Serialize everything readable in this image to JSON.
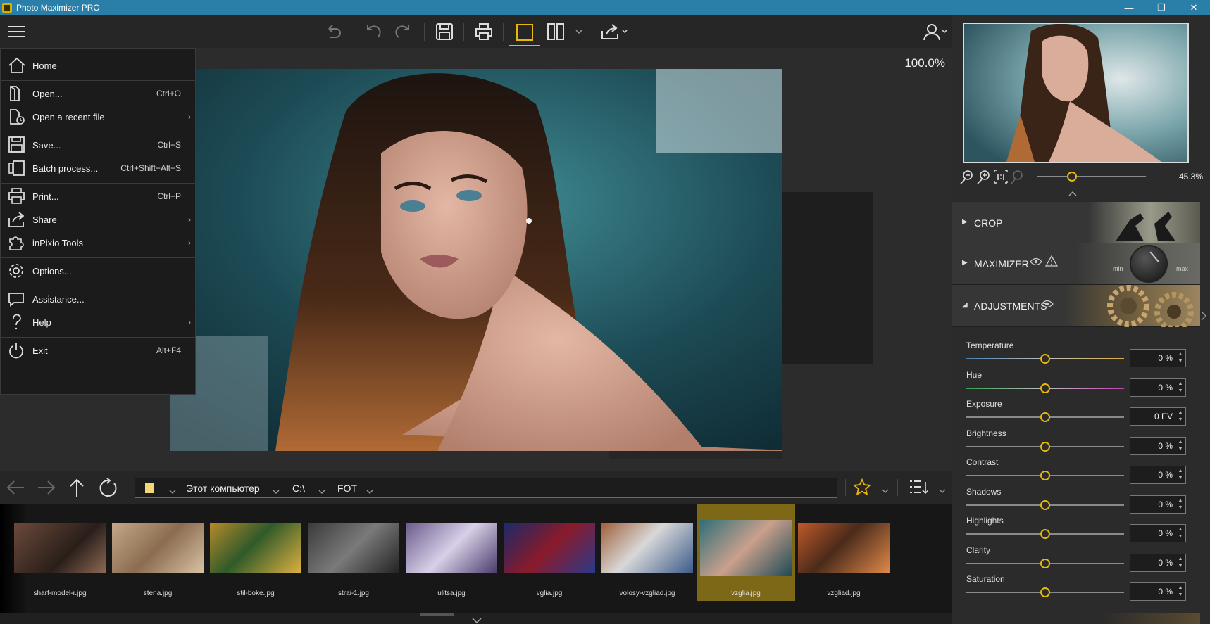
{
  "window": {
    "title": "Photo Maximizer PRO",
    "controls": [
      "—",
      "❐",
      "✕"
    ]
  },
  "canvas": {
    "zoom": "100.0%"
  },
  "menu": {
    "items": [
      {
        "label": "Home",
        "shortcut": "",
        "arrow": ""
      },
      {
        "label": "Open...",
        "shortcut": "Ctrl+O",
        "arrow": ""
      },
      {
        "label": "Open a recent file",
        "shortcut": "",
        "arrow": "›"
      },
      {
        "label": "Save...",
        "shortcut": "Ctrl+S",
        "arrow": ""
      },
      {
        "label": "Batch process...",
        "shortcut": "Ctrl+Shift+Alt+S",
        "arrow": ""
      },
      {
        "label": "Print...",
        "shortcut": "Ctrl+P",
        "arrow": ""
      },
      {
        "label": "Share",
        "shortcut": "",
        "arrow": "›"
      },
      {
        "label": "inPixio Tools",
        "shortcut": "",
        "arrow": "›"
      },
      {
        "label": "Options...",
        "shortcut": "",
        "arrow": ""
      },
      {
        "label": "Assistance...",
        "shortcut": "",
        "arrow": ""
      },
      {
        "label": "Help",
        "shortcut": "",
        "arrow": "›"
      },
      {
        "label": "Exit",
        "shortcut": "Alt+F4",
        "arrow": ""
      }
    ]
  },
  "navigator": {
    "path": [
      "Этот компьютер",
      "C:\\",
      "FOT"
    ]
  },
  "thumbnails": [
    {
      "name": "sharf-model-r.jpg"
    },
    {
      "name": "stena.jpg"
    },
    {
      "name": "stil-boke.jpg"
    },
    {
      "name": "strai-1.jpg"
    },
    {
      "name": "ulitsa.jpg"
    },
    {
      "name": "vglia.jpg"
    },
    {
      "name": "volosy-vzgliad.jpg"
    },
    {
      "name": "vzglia.jpg",
      "selected": true
    },
    {
      "name": "vzgliad.jpg"
    }
  ],
  "right_panel": {
    "zoom_percent": "45.3%",
    "zoom_level": 0.32,
    "sections": {
      "crop": "CROP",
      "maximizer": "MAXIMIZER",
      "maximizer_min": "min",
      "maximizer_max": "max",
      "adjustments": "ADJUSTMENTS"
    },
    "adjustments": [
      {
        "label": "Temperature",
        "value": "0 %",
        "level": 0.5
      },
      {
        "label": "Hue",
        "value": "0 %",
        "level": 0.5
      },
      {
        "label": "Exposure",
        "value": "0 EV",
        "level": 0.5
      },
      {
        "label": "Brightness",
        "value": "0 %",
        "level": 0.5
      },
      {
        "label": "Contrast",
        "value": "0 %",
        "level": 0.5
      },
      {
        "label": "Shadows",
        "value": "0 %",
        "level": 0.5
      },
      {
        "label": "Highlights",
        "value": "0 %",
        "level": 0.5
      },
      {
        "label": "Clarity",
        "value": "0 %",
        "level": 0.5
      },
      {
        "label": "Saturation",
        "value": "0 %",
        "level": 0.5
      }
    ]
  },
  "colors": {
    "accent": "#e8b70c",
    "titlebar": "#2a7fa8",
    "selected_thumb": "#7c6817"
  }
}
